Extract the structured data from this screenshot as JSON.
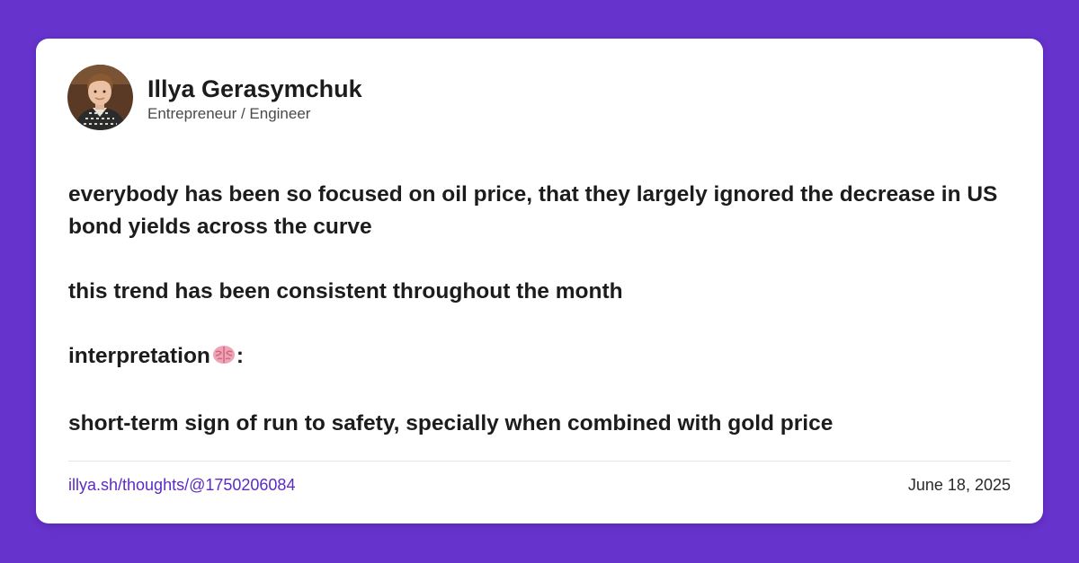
{
  "colors": {
    "background": "#6633cc",
    "card": "#ffffff",
    "link": "#5b2bc4",
    "text": "#1c1c1c"
  },
  "author": {
    "name": "Illya Gerasymchuk",
    "title": "Entrepreneur / Engineer",
    "avatar_icon": "profile-photo"
  },
  "post": {
    "line_1": "everybody has been so focused on oil price, that they largely ignored the decrease in US bond yields across the curve",
    "line_2": "this trend has been consistent throughout the month",
    "line_3_text": "interpretation",
    "line_3_suffix": ":",
    "line_3_icon": "brain-emoji",
    "line_4": "short-term sign of run to safety, specially when combined with gold price"
  },
  "footer": {
    "link": "illya.sh/thoughts/@1750206084",
    "date": "June 18, 2025"
  }
}
